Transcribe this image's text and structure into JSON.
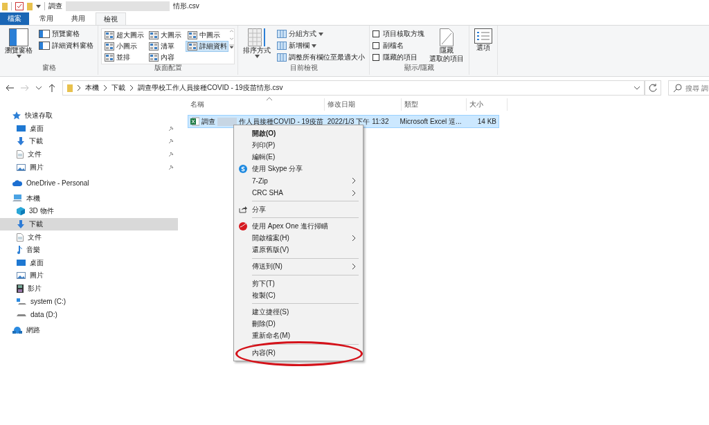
{
  "window": {
    "title_start": "調查",
    "title_end": "情形.csv"
  },
  "ribbon_tabs": [
    {
      "label": "檔案",
      "kind": "file",
      "selected": false
    },
    {
      "label": "常用",
      "kind": "tab",
      "selected": false
    },
    {
      "label": "共用",
      "kind": "tab",
      "selected": false
    },
    {
      "label": "檢視",
      "kind": "tab",
      "selected": true
    }
  ],
  "ribbon": {
    "panes": {
      "big": "瀏覽窗格",
      "small": [
        "預覽窗格",
        "詳細資料窗格"
      ],
      "label": "窗格"
    },
    "layout": {
      "options": [
        {
          "label": "超大圖示",
          "selected": false
        },
        {
          "label": "大圖示",
          "selected": false
        },
        {
          "label": "中圖示",
          "selected": false
        },
        {
          "label": "小圖示",
          "selected": false
        },
        {
          "label": "清單",
          "selected": false
        },
        {
          "label": "詳細資料",
          "selected": true
        },
        {
          "label": "並排",
          "selected": false
        },
        {
          "label": "內容",
          "selected": false
        }
      ],
      "label": "版面配置"
    },
    "current_view": {
      "big": "排序方式",
      "small": [
        {
          "label": "分組方式",
          "dropdown": true
        },
        {
          "label": "新增欄",
          "dropdown": true
        },
        {
          "label": "調整所有欄位至最適大小",
          "dropdown": false
        }
      ],
      "label": "目前檢視"
    },
    "show_hide": {
      "checkboxes": [
        {
          "label": "項目核取方塊",
          "checked": false
        },
        {
          "label": "副檔名",
          "checked": false
        },
        {
          "label": "隱藏的項目",
          "checked": false
        }
      ],
      "big": [
        "隱藏",
        "選取的項目"
      ],
      "label": "顯示/隱藏"
    },
    "options": {
      "big": "選項"
    }
  },
  "address": {
    "breadcrumbs": [
      "本機",
      "下載",
      "調查學校工作人員接種COVID - 19疫苗情形.csv"
    ],
    "search_placeholder": "搜尋 調"
  },
  "sidebar": {
    "items": [
      {
        "label": "快速存取",
        "selected": false,
        "children": [
          {
            "label": "桌面",
            "pinned": true,
            "selected": false
          },
          {
            "label": "下載",
            "pinned": true,
            "selected": false
          },
          {
            "label": "文件",
            "pinned": true,
            "selected": false
          },
          {
            "label": "圖片",
            "pinned": true,
            "selected": false
          }
        ]
      },
      {
        "label": "OneDrive - Personal",
        "selected": false
      },
      {
        "label": "本機",
        "selected": false,
        "children": [
          {
            "label": "3D 物件",
            "pinned": false,
            "selected": false
          },
          {
            "label": "下載",
            "pinned": false,
            "selected": true
          },
          {
            "label": "文件",
            "pinned": false,
            "selected": false
          },
          {
            "label": "音樂",
            "pinned": false,
            "selected": false
          },
          {
            "label": "桌面",
            "pinned": false,
            "selected": false
          },
          {
            "label": "圖片",
            "pinned": false,
            "selected": false
          },
          {
            "label": "影片",
            "pinned": false,
            "selected": false
          },
          {
            "label": "system (C:)",
            "pinned": false,
            "selected": false
          },
          {
            "label": "data (D:)",
            "pinned": false,
            "selected": false
          }
        ]
      },
      {
        "label": "網路",
        "selected": false
      }
    ]
  },
  "table": {
    "columns": [
      "名稱",
      "修改日期",
      "類型",
      "大小"
    ],
    "rows": [
      {
        "name_start": "調查",
        "name_end": "作人員接種COVID - 19疫苗",
        "modified": "2022/1/3 下午 11:32",
        "type": "Microsoft Excel 逗...",
        "size": "14 KB",
        "selected": true
      }
    ]
  },
  "context_menu": {
    "items": [
      {
        "kind": "item",
        "label": "開啟(O)",
        "bold": true,
        "submenu": false
      },
      {
        "kind": "item",
        "label": "列印(P)",
        "bold": false,
        "submenu": false
      },
      {
        "kind": "item",
        "label": "編輯(E)",
        "bold": false,
        "submenu": false
      },
      {
        "kind": "item",
        "label": "使用 Skype 分享",
        "bold": false,
        "submenu": false
      },
      {
        "kind": "item",
        "label": "7-Zip",
        "bold": false,
        "submenu": true
      },
      {
        "kind": "item",
        "label": "CRC SHA",
        "bold": false,
        "submenu": true
      },
      {
        "kind": "separator"
      },
      {
        "kind": "item",
        "label": "分享",
        "bold": false,
        "submenu": false
      },
      {
        "kind": "separator"
      },
      {
        "kind": "item",
        "label": "使用 Apex One 進行掃瞄",
        "bold": false,
        "submenu": false
      },
      {
        "kind": "item",
        "label": "開啟檔案(H)",
        "bold": false,
        "submenu": true
      },
      {
        "kind": "item",
        "label": "還原舊版(V)",
        "bold": false,
        "submenu": false
      },
      {
        "kind": "separator"
      },
      {
        "kind": "item",
        "label": "傳送到(N)",
        "bold": false,
        "submenu": true
      },
      {
        "kind": "separator"
      },
      {
        "kind": "item",
        "label": "剪下(T)",
        "bold": false,
        "submenu": false
      },
      {
        "kind": "item",
        "label": "複製(C)",
        "bold": false,
        "submenu": false
      },
      {
        "kind": "separator"
      },
      {
        "kind": "item",
        "label": "建立捷徑(S)",
        "bold": false,
        "submenu": false
      },
      {
        "kind": "item",
        "label": "刪除(D)",
        "bold": false,
        "submenu": false
      },
      {
        "kind": "item",
        "label": "重新命名(M)",
        "bold": false,
        "submenu": false
      },
      {
        "kind": "separator"
      },
      {
        "kind": "item",
        "label": "內容(R)",
        "bold": false,
        "submenu": false,
        "highlighted": true
      }
    ]
  }
}
